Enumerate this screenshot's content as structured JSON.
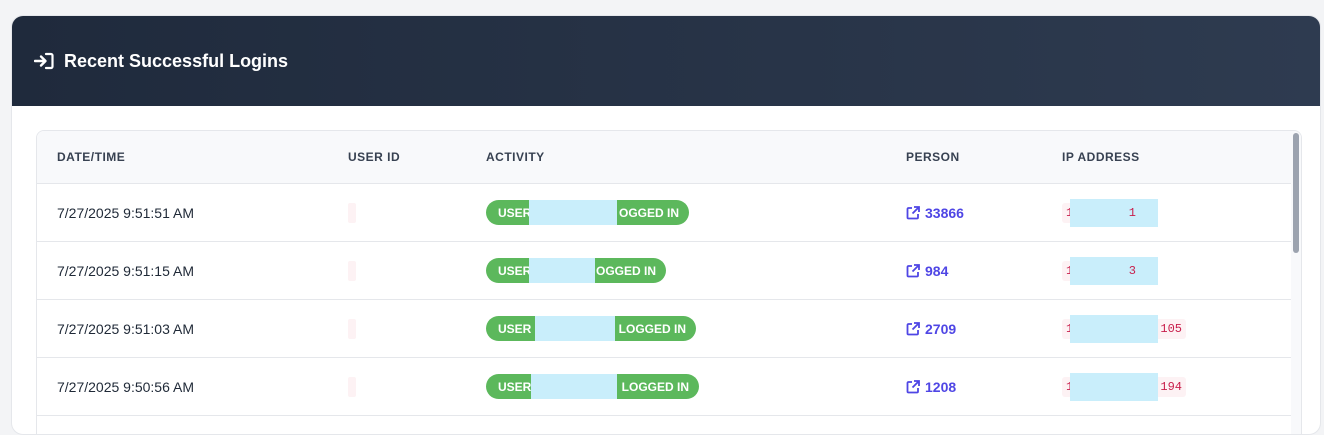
{
  "card": {
    "title": "Recent Successful Logins",
    "icon": "sign-in-icon"
  },
  "table": {
    "headers": [
      "DATE/TIME",
      "USER ID",
      "ACTIVITY",
      "PERSON",
      "IP ADDRESS"
    ],
    "rows": [
      {
        "datetime": "7/27/2025 9:51:51 AM",
        "activity_start": "USER",
        "activity_end": "OGGED IN",
        "person": "33866",
        "ip_start": "1",
        "ip_end": "1"
      },
      {
        "datetime": "7/27/2025 9:51:15 AM",
        "activity_start": "USER",
        "activity_end": "OGGED IN",
        "person": "984",
        "ip_start": "1",
        "ip_end": "3"
      },
      {
        "datetime": "7/27/2025 9:51:03 AM",
        "activity_start": "USER",
        "activity_end": "LOGGED IN",
        "person": "2709",
        "ip_start": "1",
        "ip_end": "105"
      },
      {
        "datetime": "7/27/2025 9:50:56 AM",
        "activity_start": "USER",
        "activity_end": "LOGGED IN",
        "person": "1208",
        "ip_start": "1",
        "ip_end": "194"
      }
    ]
  },
  "colors": {
    "header_bg": "#253045",
    "pill_green": "#5cb85c",
    "link": "#4f46e5",
    "ip_text": "#c81e4b",
    "redaction": "#c9eefb"
  }
}
